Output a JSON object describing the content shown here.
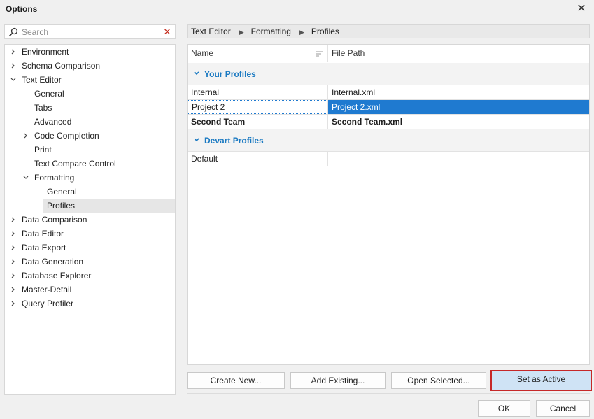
{
  "window": {
    "title": "Options",
    "close_symbol": "✕"
  },
  "search": {
    "placeholder": "Search",
    "value": "",
    "clear_symbol": "✕"
  },
  "tree": [
    {
      "label": "Environment",
      "level": 0,
      "toggle": "right"
    },
    {
      "label": "Schema Comparison",
      "level": 0,
      "toggle": "right"
    },
    {
      "label": "Text Editor",
      "level": 0,
      "toggle": "down"
    },
    {
      "label": "General",
      "level": 1,
      "toggle": "none"
    },
    {
      "label": "Tabs",
      "level": 1,
      "toggle": "none"
    },
    {
      "label": "Advanced",
      "level": 1,
      "toggle": "none"
    },
    {
      "label": "Code Completion",
      "level": 1,
      "toggle": "right"
    },
    {
      "label": "Print",
      "level": 1,
      "toggle": "none"
    },
    {
      "label": "Text Compare Control",
      "level": 1,
      "toggle": "none"
    },
    {
      "label": "Formatting",
      "level": 1,
      "toggle": "down"
    },
    {
      "label": "General",
      "level": 2,
      "toggle": "none"
    },
    {
      "label": "Profiles",
      "level": 2,
      "toggle": "none",
      "selected": true
    },
    {
      "label": "Data Comparison",
      "level": 0,
      "toggle": "right"
    },
    {
      "label": "Data Editor",
      "level": 0,
      "toggle": "right"
    },
    {
      "label": "Data Export",
      "level": 0,
      "toggle": "right"
    },
    {
      "label": "Data Generation",
      "level": 0,
      "toggle": "right"
    },
    {
      "label": "Database Explorer",
      "level": 0,
      "toggle": "right"
    },
    {
      "label": "Master-Detail",
      "level": 0,
      "toggle": "right"
    },
    {
      "label": "Query Profiler",
      "level": 0,
      "toggle": "right"
    }
  ],
  "breadcrumb": {
    "items": [
      "Text Editor",
      "Formatting",
      "Profiles"
    ],
    "separator": "▶"
  },
  "grid": {
    "columns": {
      "name": "Name",
      "path": "File Path"
    },
    "groups": [
      {
        "label": "Your Profiles",
        "rows": [
          {
            "name": "Internal",
            "path": "Internal.xml"
          },
          {
            "name": "Project 2",
            "path": "Project 2.xml",
            "selected": true
          },
          {
            "name": "Second Team",
            "path": "Second Team.xml",
            "active": true
          }
        ]
      },
      {
        "label": "Devart Profiles",
        "rows": [
          {
            "name": "Default",
            "path": ""
          }
        ]
      }
    ]
  },
  "actions": {
    "create_new": "Create New...",
    "add_existing": "Add Existing...",
    "open_selected": "Open Selected...",
    "set_active": "Set as Active"
  },
  "dialog_buttons": {
    "ok": "OK",
    "cancel": "Cancel"
  },
  "colors": {
    "accent": "#1f7ad0",
    "group_text": "#1b7ac2",
    "highlight_border": "#c62828",
    "selected_tree_bg": "#e6e6e6"
  }
}
